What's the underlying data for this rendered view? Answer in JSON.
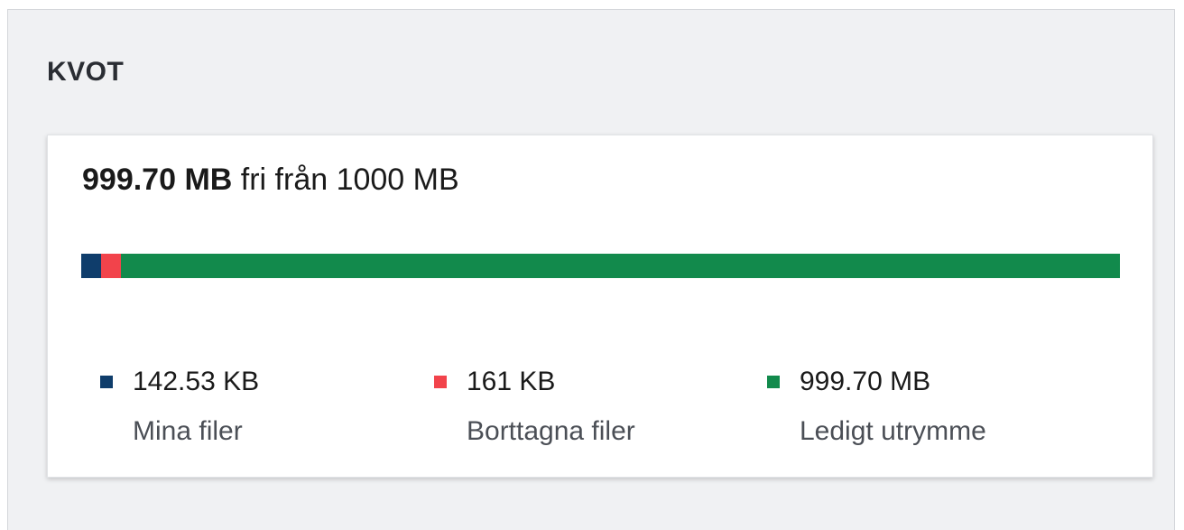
{
  "section": {
    "title": "KVOT"
  },
  "quota": {
    "free_amount": "999.70 MB",
    "free_text": "fri från 1000 MB",
    "segments": [
      {
        "name": "my-files",
        "fraction": 0.0195,
        "color": "#0f3d6b"
      },
      {
        "name": "deleted-files",
        "fraction": 0.0185,
        "color": "#f2434b"
      },
      {
        "name": "free-space",
        "fraction": 0.962,
        "color": "#128a4c"
      }
    ]
  },
  "legend": [
    {
      "value": "142.53 KB",
      "label": "Mina filer",
      "color": "#0f3d6b"
    },
    {
      "value": "161 KB",
      "label": "Borttagna filer",
      "color": "#f2434b"
    },
    {
      "value": "999.70 MB",
      "label": "Ledigt utrymme",
      "color": "#128a4c"
    }
  ]
}
